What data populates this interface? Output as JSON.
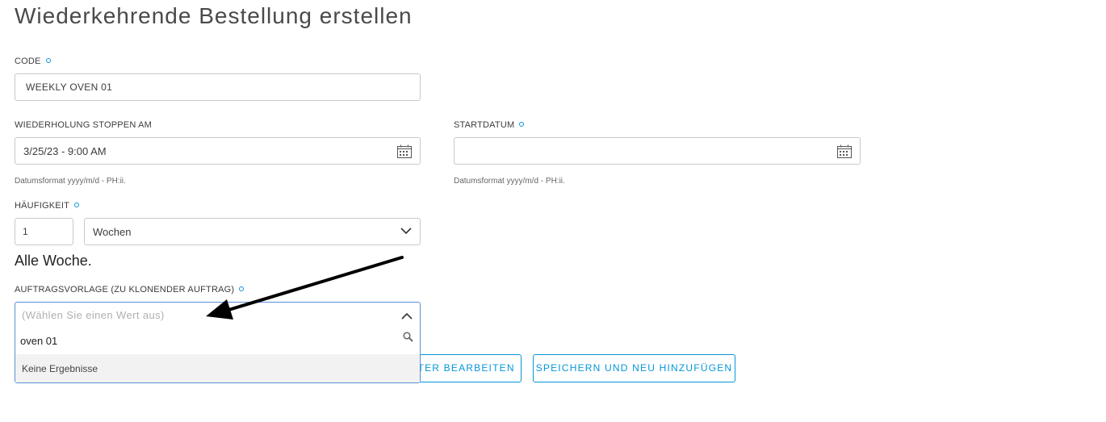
{
  "page_title": "Wiederkehrende Bestellung erstellen",
  "code": {
    "label": "CODE",
    "value": "WEEKLY OVEN 01"
  },
  "stop_repeat": {
    "label": "WIEDERHOLUNG STOPPEN AM",
    "value": "3/25/23 - 9:00 AM",
    "hint": "Datumsformat yyyy/m/d - PH:ii."
  },
  "start_date": {
    "label": "STARTDATUM",
    "value": "",
    "hint": "Datumsformat yyyy/m/d - PH:ii."
  },
  "frequency": {
    "label": "HÄUFIGKEIT",
    "number": "1",
    "unit": "Wochen",
    "summary": "Alle Woche."
  },
  "template": {
    "label": "AUFTRAGSVORLAGE (ZU KLONENDER AUFTRAG)",
    "placeholder": "(Wählen Sie einen Wert aus)",
    "search_value": "oven 01",
    "no_results": "Keine Ergebnisse"
  },
  "buttons": {
    "save_edit": "ITER BEARBEITEN",
    "save_new": "SPEICHERN UND NEU HINZUFÜGEN"
  },
  "icons": {
    "calendar": "calendar-icon",
    "chevron_down": "chevron-down-icon",
    "chevron_up": "chevron-up-icon",
    "search": "search-icon"
  },
  "colors": {
    "accent": "#0696d7",
    "dropdown_border": "#5b8fd6",
    "annotation_arrow": "#000000"
  }
}
